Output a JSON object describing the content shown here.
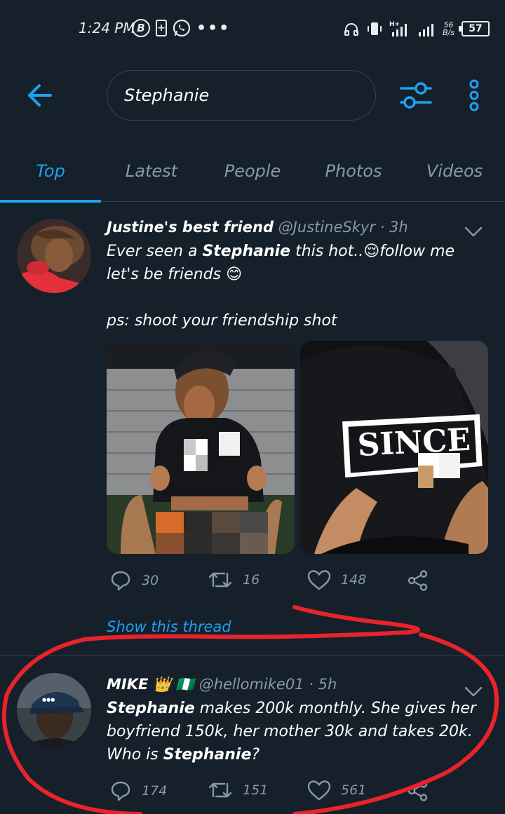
{
  "status_bar": {
    "time": "1:24 PM",
    "badge": "B",
    "dots": "•••",
    "speed_top": "56",
    "speed_bottom": "B/s",
    "battery": "57"
  },
  "search": {
    "query": "Stephanie"
  },
  "tabs": [
    {
      "label": "Top",
      "active": true
    },
    {
      "label": "Latest",
      "active": false
    },
    {
      "label": "People",
      "active": false
    },
    {
      "label": "Photos",
      "active": false
    },
    {
      "label": "Videos",
      "active": false
    }
  ],
  "tweets": [
    {
      "name": "Justine's best friend",
      "handle": "@JustineSkyr",
      "dot": "·",
      "time": "3h",
      "text_pre": "Ever seen a ",
      "text_bold": "Stephanie",
      "text_post": " this hot..😌follow me let's be friends 😊",
      "text_p2": "ps: shoot your friendship shot",
      "replies": "30",
      "retweets": "16",
      "likes": "148",
      "show_thread": "Show this thread",
      "media_text": "SINCE"
    },
    {
      "name": "MIKE",
      "name_badges": "👑 🇳🇬",
      "handle": "@hellomike01",
      "dot": "·",
      "time": "5h",
      "text_bold1": "Stephanie",
      "text_mid": " makes 200k monthly. She gives her boyfriend 150k, her mother 30k and takes 20k. Who is ",
      "text_bold2": "Stephanie",
      "text_end": "?",
      "replies": "174",
      "retweets": "151",
      "likes": "561"
    }
  ],
  "colors": {
    "background": "#15202b",
    "accent": "#1da1f2",
    "muted": "#8899a6",
    "divider": "#38444d",
    "annotation": "#e8232a"
  }
}
